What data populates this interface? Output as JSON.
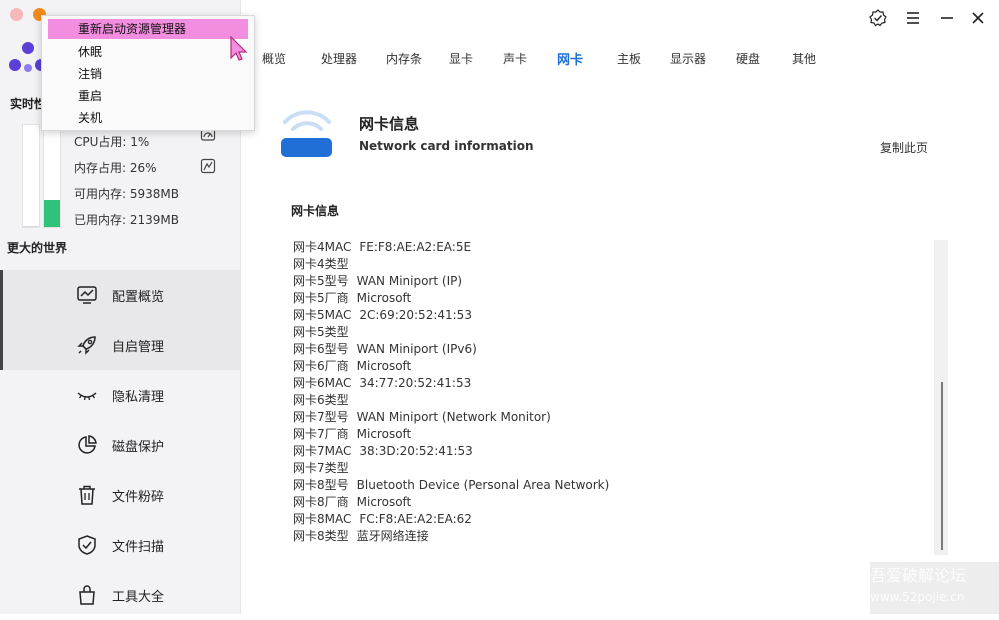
{
  "window": {
    "controls": [
      "close",
      "minimize"
    ]
  },
  "context_menu": {
    "items": [
      {
        "label": "重新启动资源管理器",
        "highlighted": true
      },
      {
        "label": "休眠",
        "highlighted": false
      },
      {
        "label": "注销",
        "highlighted": false
      },
      {
        "label": "重启",
        "highlighted": false
      },
      {
        "label": "关机",
        "highlighted": false
      }
    ]
  },
  "sidebar": {
    "realtime_title": "实时性",
    "stats": {
      "cpu": "CPU占用:  1%",
      "mem": "内存占用:  26%",
      "available": "可用内存:  5938MB",
      "used": "已用内存:  2139MB"
    },
    "bars": {
      "cpu_fraction": 0.01,
      "mem_fraction": 0.26,
      "cpu_color": "#d8d8d8",
      "mem_color": "#2fc27a"
    },
    "slogan": "更大的世界",
    "nav": [
      {
        "label": "配置概览",
        "icon": "monitor-chart-icon",
        "active": true
      },
      {
        "label": "自启管理",
        "icon": "rocket-icon",
        "active": false,
        "hover": true
      },
      {
        "label": "隐私清理",
        "icon": "eye-closed-icon",
        "active": false
      },
      {
        "label": "磁盘保护",
        "icon": "pie-chart-icon",
        "active": false
      },
      {
        "label": "文件粉碎",
        "icon": "trash-icon",
        "active": false
      },
      {
        "label": "文件扫描",
        "icon": "shield-check-icon",
        "active": false
      },
      {
        "label": "工具大全",
        "icon": "bag-icon",
        "active": false
      }
    ]
  },
  "topbar": {
    "icons": [
      "badge-check-icon",
      "menu-icon",
      "minimize-icon",
      "close-icon"
    ]
  },
  "tabs": [
    {
      "label": "概览",
      "active": false
    },
    {
      "label": "处理器",
      "active": false
    },
    {
      "label": "内存条",
      "active": false
    },
    {
      "label": "显卡",
      "active": false
    },
    {
      "label": "声卡",
      "active": false
    },
    {
      "label": "网卡",
      "active": true
    },
    {
      "label": "主板",
      "active": false
    },
    {
      "label": "显示器",
      "active": false
    },
    {
      "label": "硬盘",
      "active": false
    },
    {
      "label": "其他",
      "active": false
    }
  ],
  "content": {
    "title": "网卡信息",
    "subtitle": "Network card information",
    "copy_label": "复制此页",
    "list_title": "网卡信息",
    "rows": [
      {
        "k": "网卡4MAC",
        "v": "FE:F8:AE:A2:EA:5E"
      },
      {
        "k": "网卡4类型",
        "v": ""
      },
      {
        "k": "网卡5型号",
        "v": "WAN Miniport (IP)"
      },
      {
        "k": "网卡5厂商",
        "v": "Microsoft"
      },
      {
        "k": "网卡5MAC",
        "v": "2C:69:20:52:41:53"
      },
      {
        "k": "网卡5类型",
        "v": ""
      },
      {
        "k": "网卡6型号",
        "v": "WAN Miniport (IPv6)"
      },
      {
        "k": "网卡6厂商",
        "v": "Microsoft"
      },
      {
        "k": "网卡6MAC",
        "v": "34:77:20:52:41:53"
      },
      {
        "k": "网卡6类型",
        "v": ""
      },
      {
        "k": "网卡7型号",
        "v": "WAN Miniport (Network Monitor)"
      },
      {
        "k": "网卡7厂商",
        "v": "Microsoft"
      },
      {
        "k": "网卡7MAC",
        "v": "38:3D:20:52:41:53"
      },
      {
        "k": "网卡7类型",
        "v": ""
      },
      {
        "k": "网卡8型号",
        "v": "Bluetooth Device (Personal Area Network)"
      },
      {
        "k": "网卡8厂商",
        "v": "Microsoft"
      },
      {
        "k": "网卡8MAC",
        "v": "FC:F8:AE:A2:EA:62"
      },
      {
        "k": "网卡8类型",
        "v": "蓝牙网络连接"
      }
    ]
  },
  "colors": {
    "accent": "#1f6fd6",
    "highlight": "#f28de0",
    "wifi_blue": "#1f6fd6"
  },
  "watermark": {
    "line1": "吾爱破解论坛",
    "line2": "www.52pojie.cn"
  }
}
